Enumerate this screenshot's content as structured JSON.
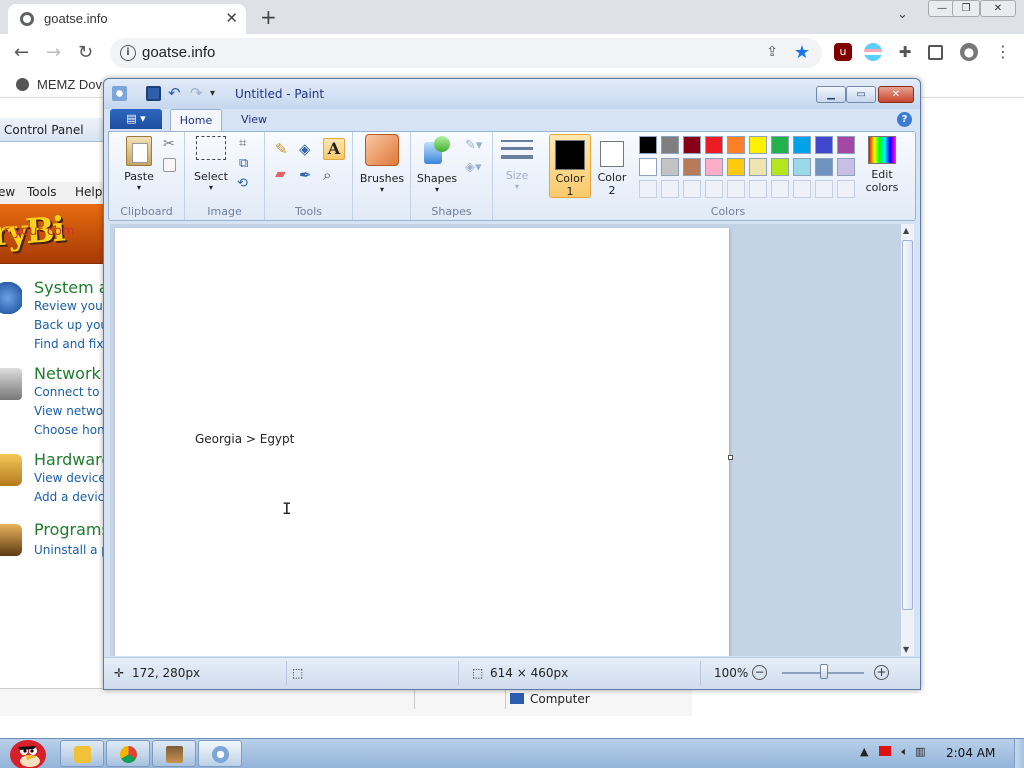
{
  "browser": {
    "tab_title": "goatse.info",
    "tab_close": "✕",
    "new_tab": "+",
    "url": "goatse.info",
    "bookmark": "MEMZ Dov",
    "window_controls": [
      "—",
      "❐",
      "✕"
    ]
  },
  "control_panel": {
    "address": "Control Panel",
    "menu": [
      "ew",
      "Tools",
      "Help"
    ],
    "banner_text": "r your com",
    "sections": [
      {
        "heading": "System a",
        "links": [
          "Review your",
          "Back up you",
          "Find and fix"
        ]
      },
      {
        "heading": "Network",
        "links": [
          "Connect to",
          "View networ",
          "Choose hon"
        ]
      },
      {
        "heading": "Hardware",
        "links": [
          "View device",
          "Add a devic"
        ]
      },
      {
        "heading": "Programs",
        "links": [
          "Uninstall a p"
        ]
      }
    ],
    "status_computer": "Computer"
  },
  "paint": {
    "title": "Untitled - Paint",
    "tabs": {
      "home": "Home",
      "view": "View"
    },
    "groups": {
      "clipboard": "Clipboard",
      "image": "Image",
      "tools": "Tools",
      "shapes": "Shapes",
      "colors": "Colors"
    },
    "buttons": {
      "paste": "Paste",
      "select": "Select",
      "brushes": "Brushes",
      "shapes": "Shapes",
      "size": "Size",
      "color1": "Color\n1",
      "color2": "Color\n2",
      "edit_colors": "Edit\ncolors"
    },
    "palette_row1": [
      "#000000",
      "#7f7f7f",
      "#880015",
      "#ed1c24",
      "#ff7f27",
      "#fff200",
      "#22b14c",
      "#00a2e8",
      "#3f48cc",
      "#a349a4"
    ],
    "palette_row2": [
      "#ffffff",
      "#c3c3c3",
      "#b97a57",
      "#ffaec9",
      "#ffc90e",
      "#efe4b0",
      "#b5e61d",
      "#99d9ea",
      "#7092be",
      "#c8bfe7"
    ],
    "canvas_text": "Georgia > Egypt",
    "status": {
      "cursor": "172, 280px",
      "size": "614 × 460px",
      "zoom": "100%"
    }
  },
  "taskbar": {
    "clock": "2:04 AM"
  }
}
